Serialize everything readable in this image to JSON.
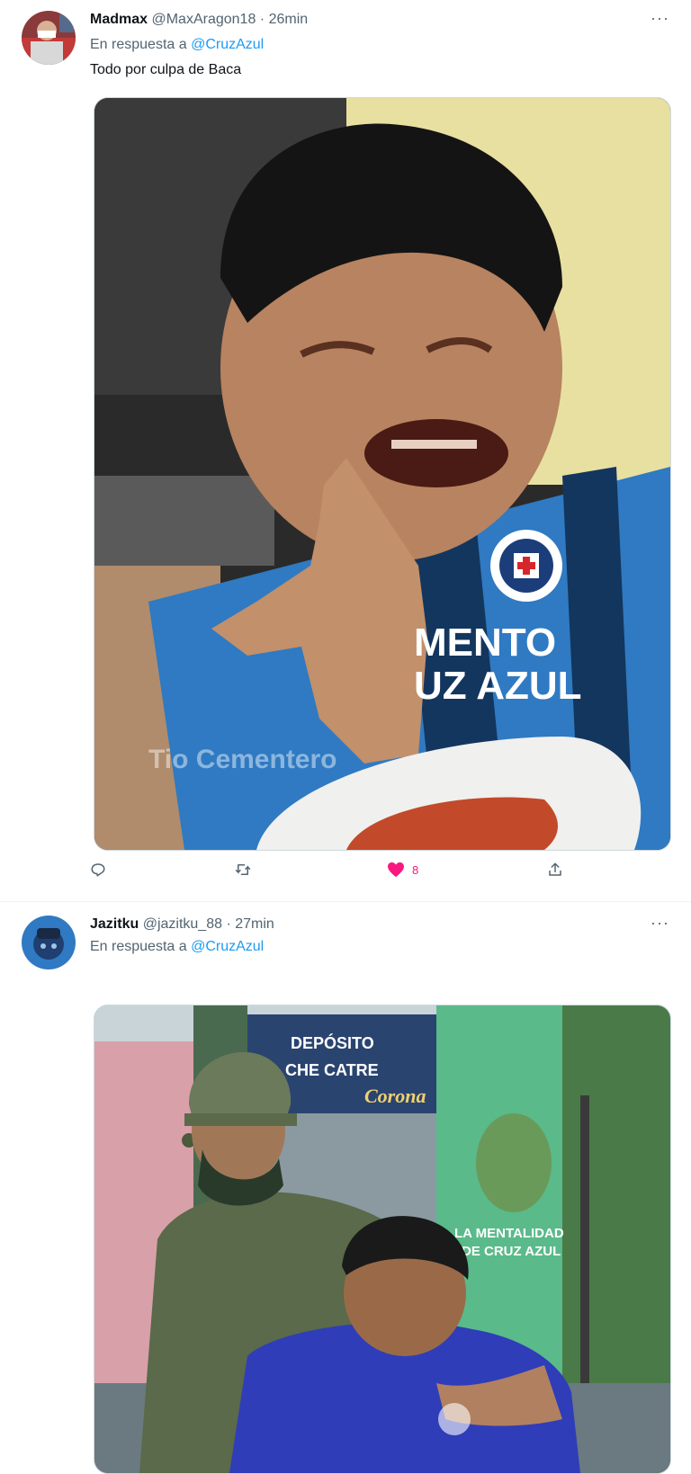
{
  "tweets": [
    {
      "name": "Madmax",
      "handle": "@MaxAragon18",
      "separator": "·",
      "time": "26min",
      "reply_prefix": "En respuesta a",
      "reply_to": "@CruzAzul",
      "text": "Todo por culpa de Baca",
      "media": {
        "jersey_line1": "MENTO",
        "jersey_line2": "UZ AZUL",
        "watermark": "Tio Cementero"
      },
      "likes": "8",
      "liked": true
    },
    {
      "name": "Jazitku",
      "handle": "@jazitku_88",
      "separator": "·",
      "time": "27min",
      "reply_prefix": "En respuesta a",
      "reply_to": "@CruzAzul",
      "media": {
        "sign_line1": "DEPÓSITO",
        "sign_line2": "CHE CATRE",
        "sign_brand": "Corona",
        "caption_line1": "LA MENTALIDAD",
        "caption_line2": "DE CRUZ AZUL"
      }
    }
  ],
  "icons": {
    "more": "more-icon",
    "reply": "reply-icon",
    "retweet": "retweet-icon",
    "like": "heart-icon",
    "share": "share-icon"
  },
  "colors": {
    "accent": "#1d9bf0",
    "like": "#f91880",
    "secondary_text": "#536471"
  }
}
